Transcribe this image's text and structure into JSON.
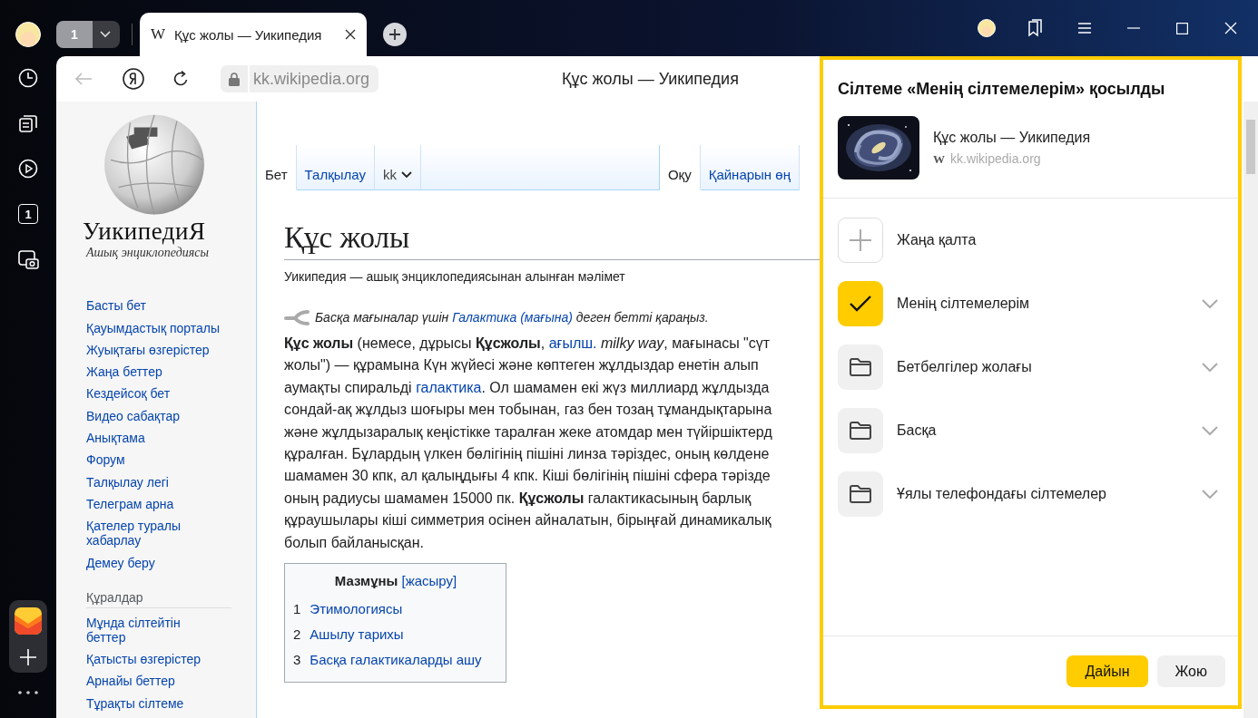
{
  "titlebar": {
    "tab_count": "1",
    "tab": {
      "favicon": "W",
      "title": "Құс жолы — Уикипедия"
    }
  },
  "sidebar": {
    "tab_count": "1"
  },
  "toolbar": {
    "address": "kk.wikipedia.org",
    "page_title": "Құс жолы — Уикипедия"
  },
  "wiki": {
    "logo_title": "УикипедиЯ",
    "logo_subtitle": "Ашық энциклопедиясы",
    "nav": [
      "Басты бет",
      "Қауымдастық порталы",
      "Жуықтағы өзгерістер",
      "Жаңа беттер",
      "Кездейсоқ бет",
      "Видео сабақтар",
      "Анықтама",
      "Форум",
      "Талқылау легі",
      "Телеграм арна",
      "Қателер туралы хабарлау",
      "Демеу беру"
    ],
    "tools_heading": "Құралдар",
    "tools": [
      "Мұнда сілтейтін беттер",
      "Қатысты өзгерістер",
      "Арнайы беттер",
      "Тұрақты сілтеме"
    ],
    "page_tabs": [
      {
        "label": "Бет",
        "selected": true,
        "kind": "plain"
      },
      {
        "label": "Талқылау",
        "selected": false,
        "kind": "plain"
      },
      {
        "label": "kk",
        "selected": false,
        "kind": "dropdown"
      }
    ],
    "view_tabs": [
      {
        "label": "Оқу",
        "selected": true
      },
      {
        "label": "Қайнарын өң",
        "selected": false
      }
    ],
    "title": "Құс жолы",
    "tagline": "Уикипедия — ашық энциклопедиясынан алынған мәлімет",
    "hatnote": [
      {
        "kind": "text",
        "text": "Басқа мағыналар үшін "
      },
      {
        "kind": "link",
        "text": "Галактика (мағына)"
      },
      {
        "kind": "text",
        "text": " деген бетті қараңыз."
      }
    ],
    "paragraph": [
      [
        {
          "kind": "bold",
          "text": "Құс жолы"
        },
        {
          "kind": "text",
          "text": " (немесе, дұрысы "
        },
        {
          "kind": "bold",
          "text": "Құсжолы"
        },
        {
          "kind": "text",
          "text": ", "
        },
        {
          "kind": "link",
          "text": "ағылш."
        },
        {
          "kind": "italic",
          "text": " milky way"
        },
        {
          "kind": "text",
          "text": ", мағынасы \"сүт"
        }
      ],
      [
        {
          "kind": "text",
          "text": "жолы\") — құрамына Күн жүйесі және көптеген жұлдыздар енетін алып"
        }
      ],
      [
        {
          "kind": "text",
          "text": "аумақты спиральді "
        },
        {
          "kind": "link",
          "text": "галактика"
        },
        {
          "kind": "text",
          "text": ". Ол шамамен екі жүз миллиард жұлдызда"
        }
      ],
      [
        {
          "kind": "text",
          "text": "сондай-ақ жұлдыз шоғыры мен тобынан, газ бен тозаң тұмандықтарына"
        }
      ],
      [
        {
          "kind": "text",
          "text": "және жұлдызаралық кеңістікке таралған жеке атомдар мен түйіршіктерд"
        }
      ],
      [
        {
          "kind": "text",
          "text": "құралған. Бұлардың үлкен бөлігінің пішіні линза тәріздес, оның көлдене"
        }
      ],
      [
        {
          "kind": "text",
          "text": "шамамен 30 кпк, ал қалыңдығы 4 кпк. Кіші бөлігінің пішіні сфера тәрізде"
        }
      ],
      [
        {
          "kind": "text",
          "text": "оның радиусы шамамен 15000 пк. "
        },
        {
          "kind": "bold",
          "text": "Құсжолы"
        },
        {
          "kind": "text",
          "text": " галактикасының барлық"
        }
      ],
      [
        {
          "kind": "text",
          "text": "құраушылары кіші симметрия осінен айналатын, бірыңғай динамикалық"
        }
      ],
      [
        {
          "kind": "text",
          "text": "болып байланысқан."
        }
      ]
    ],
    "toc": {
      "heading": "Мазмұны",
      "toggle": "[жасыру]",
      "items": [
        {
          "number": "1",
          "label": "Этимологиясы"
        },
        {
          "number": "2",
          "label": "Ашылу тарихы"
        },
        {
          "number": "3",
          "label": "Басқа галактикаларды ашу"
        }
      ]
    }
  },
  "popup": {
    "title": "Сілтеме «Менің сілтемелерім» қосылды",
    "page": {
      "title": "Құс жолы — Уикипедия",
      "favicon": "W",
      "url": "kk.wikipedia.org"
    },
    "folders": [
      {
        "kind": "new",
        "label": "Жаңа қалта",
        "selected": false
      },
      {
        "kind": "folder",
        "label": "Менің сілтемелерім",
        "selected": true
      },
      {
        "kind": "folder",
        "label": "Бетбелгілер жолағы",
        "selected": false
      },
      {
        "kind": "folder",
        "label": "Басқа",
        "selected": false
      },
      {
        "kind": "folder",
        "label": "Ұялы телефондағы сілтемелер",
        "selected": false
      }
    ],
    "buttons": [
      {
        "label": "Дайын",
        "kind": "primary"
      },
      {
        "label": "Жою",
        "kind": "secondary"
      }
    ]
  }
}
